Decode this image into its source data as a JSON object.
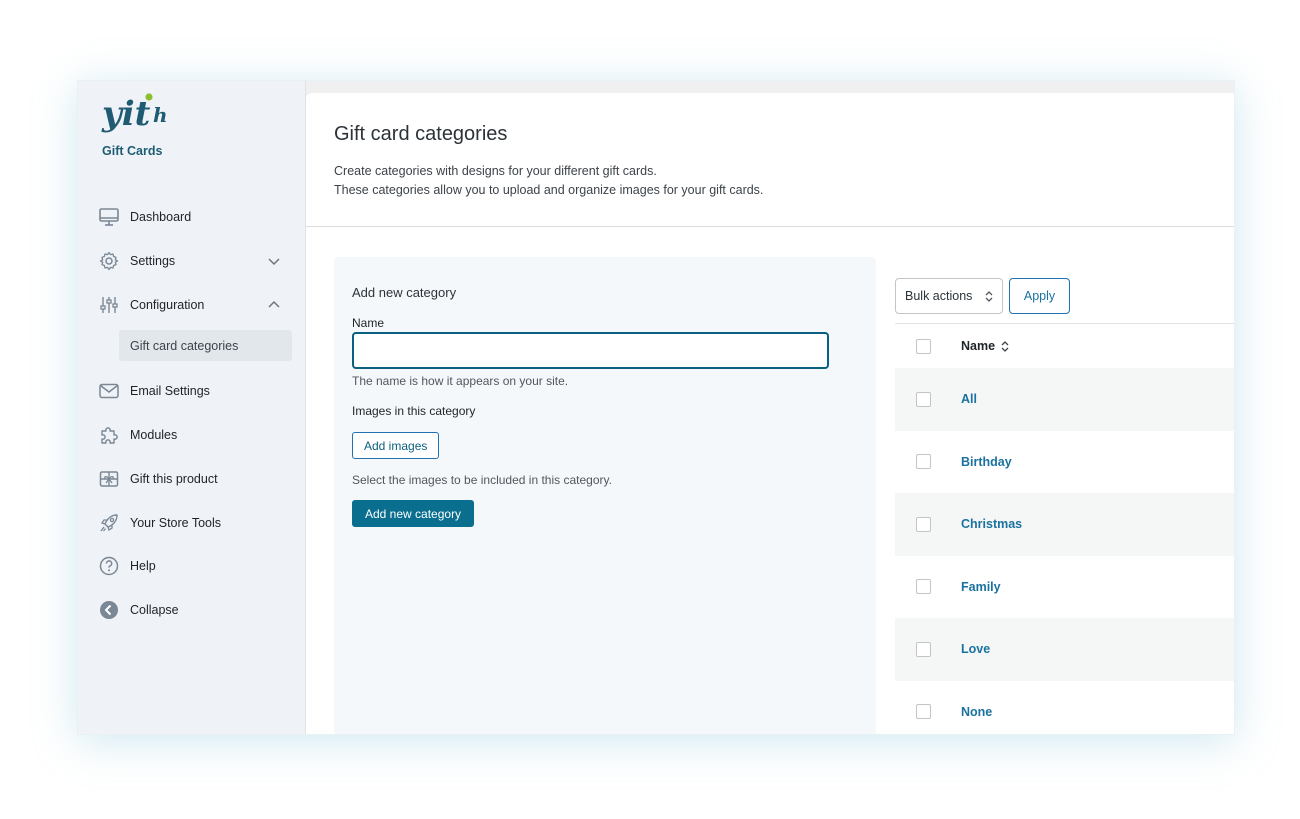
{
  "app": {
    "logo_name": "yith",
    "subtitle": "Gift Cards"
  },
  "sidebar": {
    "items": [
      {
        "label": "Dashboard",
        "icon": "monitor-icon"
      },
      {
        "label": "Settings",
        "icon": "gear-icon",
        "chevron": "down"
      },
      {
        "label": "Configuration",
        "icon": "sliders-icon",
        "chevron": "up"
      },
      {
        "label": "Email Settings",
        "icon": "envelope-icon"
      },
      {
        "label": "Modules",
        "icon": "puzzle-icon"
      },
      {
        "label": "Gift this product",
        "icon": "gift-icon"
      },
      {
        "label": "Your Store Tools",
        "icon": "rocket-icon"
      },
      {
        "label": "Help",
        "icon": "question-circle-icon"
      },
      {
        "label": "Collapse",
        "icon": "collapse-arrow-icon"
      }
    ],
    "active_subitem": "Gift card categories"
  },
  "header": {
    "title": "Gift card categories",
    "description_line1": "Create categories with designs for your different gift cards.",
    "description_line2": "These categories allow you to upload and organize images for your gift cards."
  },
  "form": {
    "title": "Add new category",
    "name_label": "Name",
    "name_value": "",
    "name_hint": "The name is how it appears on your site.",
    "images_label": "Images in this category",
    "add_images_button": "Add images",
    "images_hint": "Select the images to be included in this category.",
    "submit_button": "Add new category"
  },
  "table": {
    "bulk_actions_label": "Bulk actions",
    "apply_button": "Apply",
    "column_name": "Name",
    "rows": [
      "All",
      "Birthday",
      "Christmas",
      "Family",
      "Love",
      "None"
    ]
  },
  "colors": {
    "brand": "#1f5c74",
    "accent_green": "#8bbf2f",
    "link": "#1a72a0",
    "primary_button": "#0a6e8f"
  }
}
